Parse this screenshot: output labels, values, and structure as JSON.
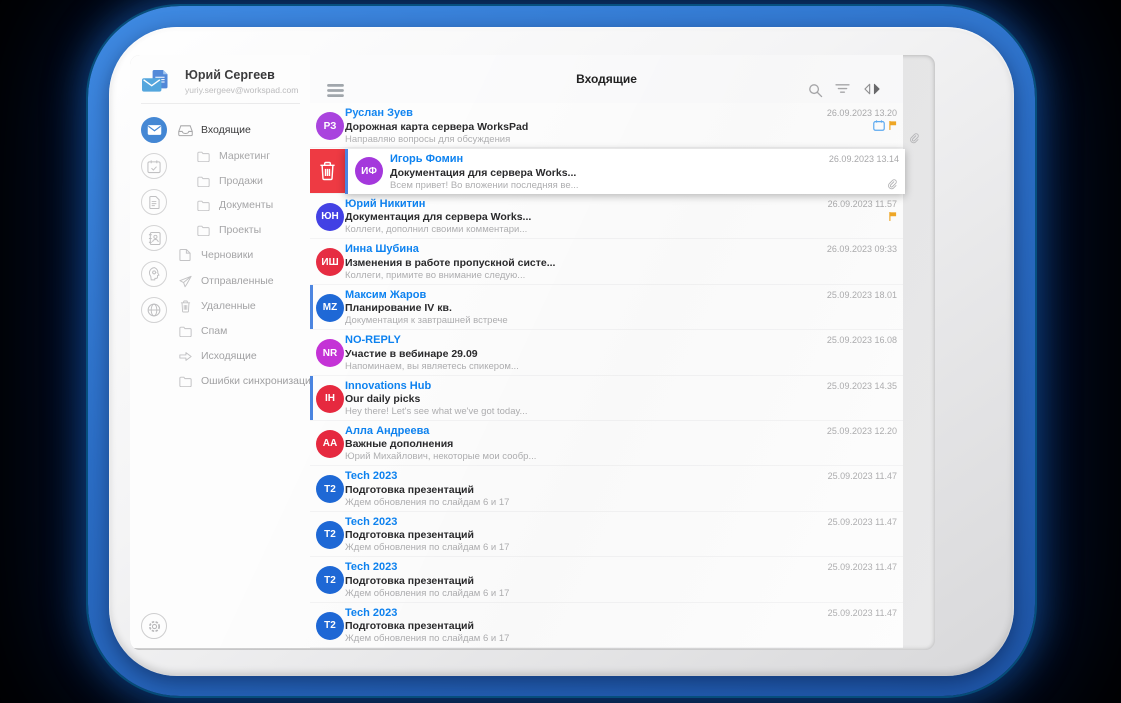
{
  "device": {
    "type": "tablet-mockup"
  },
  "colors": {
    "bezel_blue": "#2b6ec6",
    "glow_cyan": "#00d7ff",
    "accent_blue": "#2070cc",
    "name_blue": "#0d82f0",
    "unread_bar": "#4a84e0",
    "delete_red": "#ee3a43",
    "flag_orange": "#f0a41c",
    "calendar_blue": "#57a8f2"
  },
  "user": {
    "name": "Юрий Сергеев",
    "email": "yuriy.sergeev@workspad.com",
    "logo_icon": "mail-document-logo"
  },
  "rail": {
    "items": [
      {
        "icon": "mail-icon",
        "active": true
      },
      {
        "icon": "calendar-check-icon",
        "active": false
      },
      {
        "icon": "documents-icon",
        "active": false
      },
      {
        "icon": "contacts-icon",
        "active": false
      },
      {
        "icon": "assistant-head-icon",
        "active": false
      },
      {
        "icon": "globe-icon",
        "active": false
      }
    ],
    "settings_icon": "gear-icon"
  },
  "sidebar": {
    "items": [
      {
        "label": "Входящие",
        "icon": "inbox",
        "level": 0,
        "active": true
      },
      {
        "label": "Маркетинг",
        "icon": "folder",
        "level": 1,
        "active": false
      },
      {
        "label": "Продажи",
        "icon": "folder",
        "level": 1,
        "active": false
      },
      {
        "label": "Документы",
        "icon": "folder",
        "level": 1,
        "active": false
      },
      {
        "label": "Проекты",
        "icon": "folder",
        "level": 1,
        "active": false
      },
      {
        "label": "Черновики",
        "icon": "draft",
        "level": 0,
        "active": false
      },
      {
        "label": "Отправленные",
        "icon": "send",
        "level": 0,
        "active": false
      },
      {
        "label": "Удаленные",
        "icon": "trash",
        "level": 0,
        "active": false
      },
      {
        "label": "Спам",
        "icon": "folder",
        "level": 0,
        "active": false
      },
      {
        "label": "Исходящие",
        "icon": "outgoing",
        "level": 0,
        "active": false
      },
      {
        "label": "Ошибки синхронизации",
        "icon": "folder",
        "level": 0,
        "active": false
      }
    ]
  },
  "header": {
    "title": "Входящие",
    "icons": [
      "menu-icon",
      "search-icon",
      "filter-icon",
      "split-view-icon"
    ]
  },
  "emails": [
    {
      "initials": "РЗ",
      "avatar_color": "#a438dc",
      "name": "Руслан Зуев",
      "subject": "Дорожная карта сервера WorksPad",
      "preview": "Направляю вопросы для обсуждения",
      "date": "26.09.2023 13.20",
      "unread": false,
      "has_calendar": true,
      "has_flag": true,
      "has_paperclip": true,
      "paperclip_edge": true,
      "swiped": false
    },
    {
      "initials": "ИФ",
      "avatar_color": "#a438dc",
      "name": "Игорь Фомин",
      "subject": "Документация для сервера Works...",
      "preview": "Всем привет! Во вложении последняя ве...",
      "date": "26.09.2023 13.14",
      "unread": true,
      "has_calendar": false,
      "has_flag": false,
      "has_paperclip": true,
      "paperclip_edge": false,
      "swiped": true,
      "swipe_action": "delete"
    },
    {
      "initials": "ЮН",
      "avatar_color": "#3d3be3",
      "name": "Юрий Никитин",
      "subject": "Документация для сервера Works...",
      "preview": "Коллеги, дополнил своими комментари...",
      "date": "26.09.2023 11.57",
      "unread": false,
      "has_calendar": false,
      "has_flag": true,
      "has_paperclip": false,
      "paperclip_edge": false,
      "swiped": false
    },
    {
      "initials": "ИШ",
      "avatar_color": "#e6293f",
      "name": "Инна Шубина",
      "subject": "Изменения в работе пропускной систе...",
      "preview": "Коллеги, примите во внимание следую...",
      "date": "26.09.2023 09:33",
      "unread": false,
      "has_calendar": false,
      "has_flag": false,
      "has_paperclip": false,
      "paperclip_edge": false,
      "swiped": false
    },
    {
      "initials": "MZ",
      "avatar_color": "#1e68d6",
      "name": "Максим Жаров",
      "subject": "Планирование IV кв.",
      "preview": "Документация к завтрашней встрече",
      "date": "25.09.2023 18.01",
      "unread": true,
      "has_calendar": false,
      "has_flag": false,
      "has_paperclip": false,
      "paperclip_edge": false,
      "swiped": false
    },
    {
      "initials": "NR",
      "avatar_color": "#c433d6",
      "name": "NO-REPLY",
      "subject": "Участие в вебинаре 29.09",
      "preview": "Напоминаем, вы являетесь спикером...",
      "date": "25.09.2023 16.08",
      "unread": false,
      "has_calendar": false,
      "has_flag": false,
      "has_paperclip": false,
      "paperclip_edge": false,
      "swiped": false
    },
    {
      "initials": "IH",
      "avatar_color": "#e6293f",
      "name": "Innovations Hub",
      "subject": "Our daily picks",
      "preview": "Hey there! Let's see what we've got today...",
      "date": "25.09.2023 14.35",
      "unread": true,
      "has_calendar": false,
      "has_flag": false,
      "has_paperclip": false,
      "paperclip_edge": false,
      "swiped": false
    },
    {
      "initials": "AA",
      "avatar_color": "#e6293f",
      "name": "Алла Андреева",
      "subject": "Важные дополнения",
      "preview": "Юрий Михайлович, некоторые мои сообр...",
      "date": "25.09.2023 12.20",
      "unread": false,
      "has_calendar": false,
      "has_flag": false,
      "has_paperclip": false,
      "paperclip_edge": false,
      "swiped": false
    },
    {
      "initials": "T2",
      "avatar_color": "#1e68d6",
      "name": "Tech 2023",
      "subject": "Подготовка презентаций",
      "preview": "Ждем обновления по слайдам 6 и 17",
      "date": "25.09.2023 11.47",
      "unread": false,
      "has_calendar": false,
      "has_flag": false,
      "has_paperclip": false,
      "paperclip_edge": false,
      "swiped": false
    },
    {
      "initials": "T2",
      "avatar_color": "#1e68d6",
      "name": "Tech 2023",
      "subject": "Подготовка презентаций",
      "preview": "Ждем обновления по слайдам 6 и 17",
      "date": "25.09.2023 11.47",
      "unread": false,
      "has_calendar": false,
      "has_flag": false,
      "has_paperclip": false,
      "paperclip_edge": false,
      "swiped": false
    },
    {
      "initials": "T2",
      "avatar_color": "#1e68d6",
      "name": "Tech 2023",
      "subject": "Подготовка презентаций",
      "preview": "Ждем обновления по слайдам 6 и 17",
      "date": "25.09.2023 11.47",
      "unread": false,
      "has_calendar": false,
      "has_flag": false,
      "has_paperclip": false,
      "paperclip_edge": false,
      "swiped": false
    },
    {
      "initials": "T2",
      "avatar_color": "#1e68d6",
      "name": "Tech 2023",
      "subject": "Подготовка презентаций",
      "preview": "Ждем обновления по слайдам 6 и 17",
      "date": "25.09.2023 11.47",
      "unread": false,
      "has_calendar": false,
      "has_flag": false,
      "has_paperclip": false,
      "paperclip_edge": false,
      "swiped": false
    }
  ]
}
